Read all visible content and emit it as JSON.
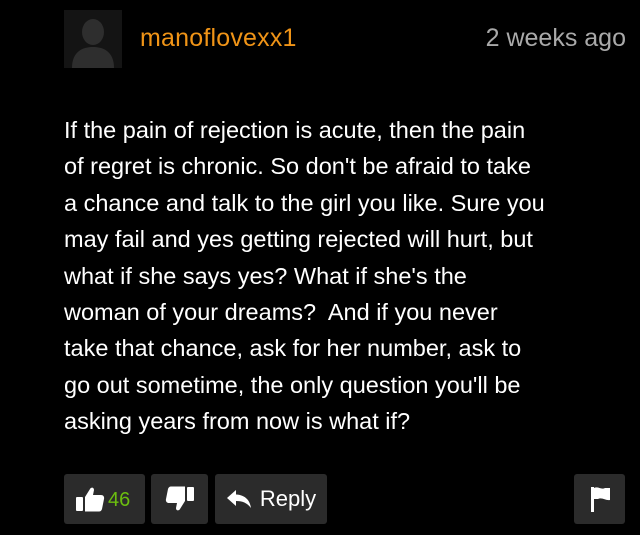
{
  "comment": {
    "username": "manoflovexx1",
    "timestamp": "2 weeks ago",
    "body_lines": [
      "If the pain of rejection is acute, then the pain",
      "of regret is chronic. So don't be afraid to take",
      "a chance and talk to the girl you like. Sure you",
      "may fail and yes getting rejected will hurt, but",
      "what if she says yes? What if she's the",
      "woman of your dreams?  And if you never",
      "take that chance, ask for her number, ask to",
      "go out sometime, the only question you'll be",
      "asking years from now is what if?"
    ],
    "avatar_icon": "default-user-silhouette-icon"
  },
  "actions": {
    "like_count": "46",
    "like_icon": "thumbs-up-icon",
    "dislike_icon": "thumbs-down-icon",
    "reply_label": "Reply",
    "reply_icon": "reply-arrow-icon",
    "flag_icon": "flag-icon"
  },
  "colors": {
    "background": "#000000",
    "username": "#f09417",
    "timestamp": "#a9a9a9",
    "body_text": "#ffffff",
    "button_bg": "#2b2b2b",
    "like_count": "#6bbd0f"
  }
}
